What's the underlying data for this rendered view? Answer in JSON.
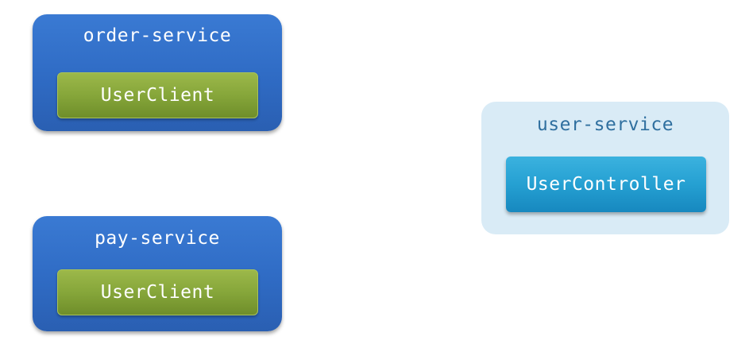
{
  "services": [
    {
      "title": "order-service",
      "component": "UserClient"
    },
    {
      "title": "pay-service",
      "component": "UserClient"
    },
    {
      "title": "user-service",
      "component": "UserController"
    }
  ],
  "colors": {
    "client_service_bg": "#2f6bc4",
    "client_component_bg": "#86a63a",
    "provider_service_bg": "#d9ebf6",
    "provider_title": "#2f6f9f",
    "provider_component_bg": "#25a0d2"
  }
}
